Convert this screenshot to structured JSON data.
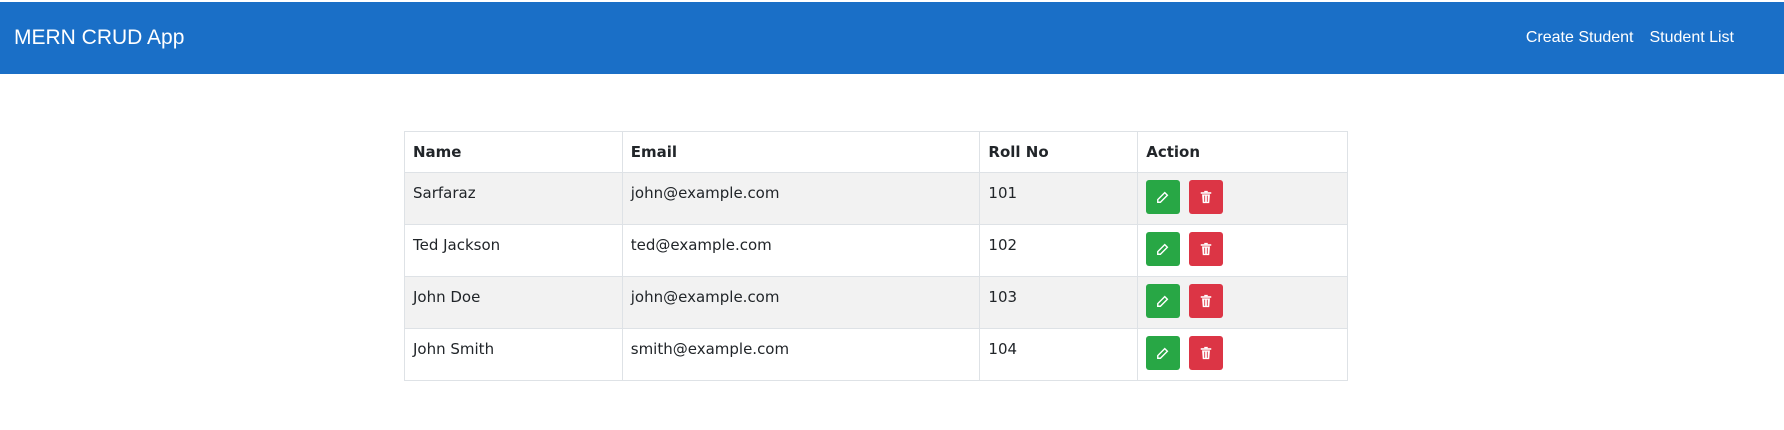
{
  "navbar": {
    "brand": "MERN CRUD App",
    "links": [
      "Create Student",
      "Student List"
    ],
    "background_color": "#1a6fc7"
  },
  "table": {
    "headers": [
      "Name",
      "Email",
      "Roll No",
      "Action"
    ],
    "rows": [
      {
        "name": "Sarfaraz",
        "email": "john@example.com",
        "roll_no": "101"
      },
      {
        "name": "Ted Jackson",
        "email": "ted@example.com",
        "roll_no": "102"
      },
      {
        "name": "John Doe",
        "email": "john@example.com",
        "roll_no": "103"
      },
      {
        "name": "John Smith",
        "email": "smith@example.com",
        "roll_no": "104"
      }
    ],
    "actions": {
      "edit_icon": "edit-icon",
      "delete_icon": "trash-icon",
      "edit_color": "#28a745",
      "delete_color": "#dc3545"
    }
  }
}
